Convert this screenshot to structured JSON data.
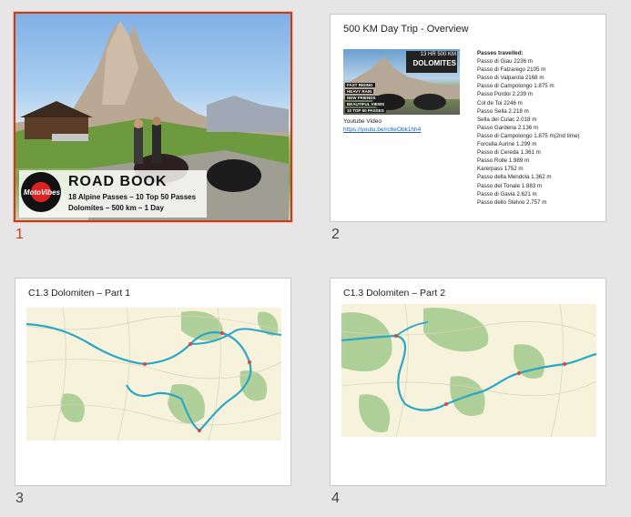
{
  "slides": [
    {
      "number": "1",
      "selected": true,
      "logo_text": "MotoVibes",
      "title": "ROAD BOOK",
      "subtitle_lines": [
        "18 Alpine Passes – 10 Top 50 Passes",
        "Dolomites – 500 km – 1 Day"
      ]
    },
    {
      "number": "2",
      "title": "500 KM Day Trip - Overview",
      "video": {
        "header_line1": "13 HR 500 KM",
        "header_line2": "DOLOMITES",
        "tags": [
          "FAST RIDING",
          "HEAVY RAIN",
          "NEW FRIENDS",
          "BEAUTIFUL VIEWS",
          "10 TOP 50 PASSES"
        ]
      },
      "caption": "Youtube Video",
      "link": "https://youtu.be/rc6eObk1hh4",
      "passes_heading": "Passes travelled:",
      "passes": [
        "Passo di Giau   2236 m",
        "Passo di Falzarego   2105 m",
        "Passo di Valparola   2168 m",
        "Passo di Campolongo   1.875 m",
        "Passo Pordoi   2.239 m",
        "Col de Toi   2246 m",
        "Passo Sella   2.218 m",
        "Sella del Culac   2.018 m",
        "Passo Gardena   2.136 m",
        "Passo di Campolongo   1.875 m(2nd time)",
        "Forcella Aurine   1.299 m",
        "Passo di Cereda   1.361 m",
        "Passo Rolle   1.989 m",
        "Karerpass   1752 m",
        "Passo della Mendola   1.362 m",
        "Passo del Tonale   1.883 m",
        "Passo di Gavia   2.621 m",
        "Passo dello Stelvio   2.757 m"
      ]
    },
    {
      "number": "3",
      "title": "C1.3 Dolomiten – Part 1"
    },
    {
      "number": "4",
      "title": "C1.3 Dolomiten – Part 2"
    }
  ],
  "colors": {
    "selection": "#c43e1c",
    "route": "#2aa7c7",
    "forest": "#9cc28a",
    "link": "#1a5fbf"
  }
}
